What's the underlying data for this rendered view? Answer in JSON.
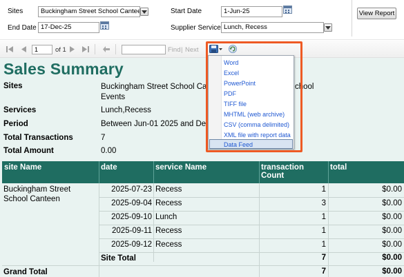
{
  "params": {
    "sites_label": "Sites",
    "sites_value": "Buckingham Street School Canteen, E",
    "start_date_label": "Start Date",
    "start_date_value": "1-Jun-25",
    "end_date_label": "End Date",
    "end_date_value": "17-Dec-25",
    "supplier_services_label": "Supplier Services",
    "supplier_services_value": "Lunch, Recess",
    "view_report_label": "View Report"
  },
  "toolbar": {
    "page_value": "1",
    "page_of": "of 1",
    "find_label": "Find",
    "separator": "|",
    "next_label": "Next"
  },
  "export_menu": {
    "items": [
      "Word",
      "Excel",
      "PowerPoint",
      "PDF",
      "TIFF file",
      "MHTML (web archive)",
      "CSV (comma delimited)",
      "XML file with report data",
      "Data Feed"
    ],
    "selected": "Data Feed",
    "highlight_color": "#ee5a24"
  },
  "report": {
    "title": "Sales Summary",
    "summary": {
      "sites_label": "Sites",
      "sites_value_line1": "Buckingham Street School Cant",
      "sites_value_line1_tail": "chool",
      "sites_value_line2": "Events",
      "services_label": "Services",
      "services_value": "Lunch,Recess",
      "period_label": "Period",
      "period_value": "Between Jun-01 2025 and Dec-",
      "total_transactions_label": "Total Transactions",
      "total_transactions_value": "7",
      "total_amount_label": "Total Amount",
      "total_amount_value": "0.00"
    },
    "columns": [
      "site Name",
      "date",
      "service Name",
      "transaction Count",
      "total"
    ],
    "site_name": "Buckingham Street School Canteen",
    "rows": [
      {
        "date": "2025-07-23",
        "service": "Recess",
        "count": "1",
        "total": "$0.00"
      },
      {
        "date": "2025-09-04",
        "service": "Recess",
        "count": "3",
        "total": "$0.00"
      },
      {
        "date": "2025-09-10",
        "service": "Lunch",
        "count": "1",
        "total": "$0.00"
      },
      {
        "date": "2025-09-11",
        "service": "Recess",
        "count": "1",
        "total": "$0.00"
      },
      {
        "date": "2025-09-12",
        "service": "Recess",
        "count": "1",
        "total": "$0.00"
      }
    ],
    "site_total_label": "Site Total",
    "site_total_count": "7",
    "site_total_amount": "$0.00",
    "grand_total_label": "Grand Total",
    "grand_total_count": "7",
    "grand_total_amount": "$0.00",
    "colors": {
      "header_bg": "#1f6d61",
      "title": "#1f6d61",
      "body_bg": "#e9f3f1"
    }
  }
}
